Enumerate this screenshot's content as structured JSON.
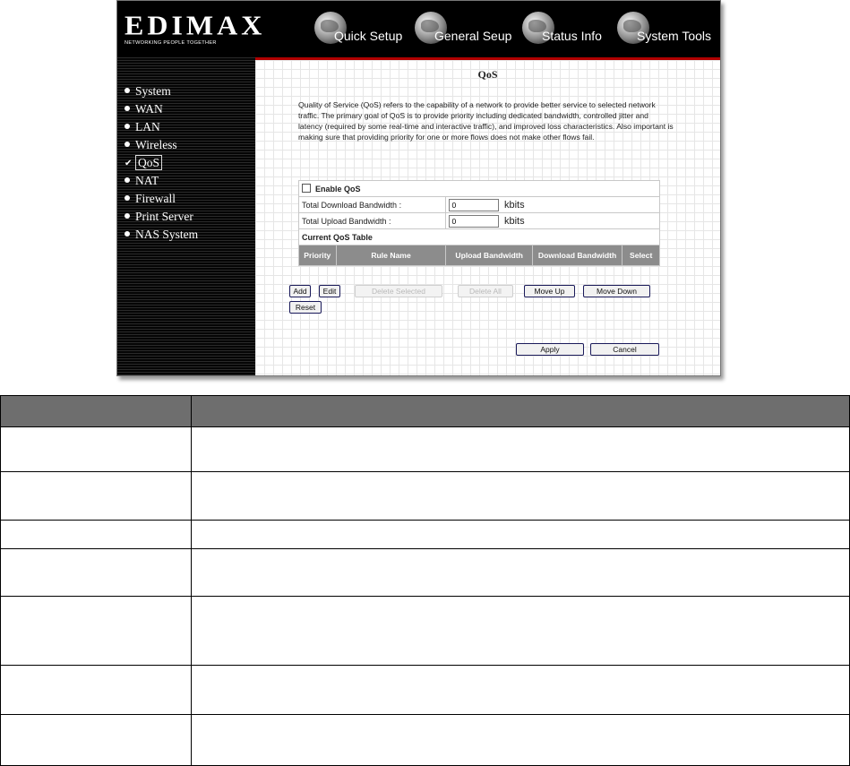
{
  "brand": {
    "logo": "EDIMAX",
    "tagline": "NETWORKING PEOPLE TOGETHER"
  },
  "nav": [
    "Quick Setup",
    "General Seup",
    "Status Info",
    "System Tools"
  ],
  "sidebar": {
    "items": [
      "System",
      "WAN",
      "LAN",
      "Wireless",
      "QoS",
      "NAT",
      "Firewall",
      "Print Server",
      "NAS System"
    ],
    "active": "QoS"
  },
  "page": {
    "title": "QoS",
    "description": "Quality of Service (QoS) refers to the capability of a network to provide better service to selected network traffic. The primary goal of QoS is to provide priority including dedicated bandwidth, controlled jitter and latency (required by some real-time and interactive traffic), and improved loss characteristics. Also important is making sure that providing priority for one or more flows does not make other flows fail."
  },
  "qos_form": {
    "enable_label": "Enable QoS",
    "enable_checked": false,
    "download_label": "Total Download Bandwidth :",
    "download_value": "0",
    "upload_label": "Total Upload Bandwidth :",
    "upload_value": "0",
    "unit": "kbits",
    "table_title": "Current QoS Table",
    "columns": [
      "Priority",
      "Rule Name",
      "Upload Bandwidth",
      "Download Bandwidth",
      "Select"
    ]
  },
  "buttons": {
    "add": "Add",
    "edit": "Edit",
    "delete_selected": "Delete Selected",
    "delete_all": "Delete All",
    "move_up": "Move Up",
    "move_down": "Move Down",
    "reset": "Reset",
    "apply": "Apply",
    "cancel": "Cancel"
  },
  "doc_table": {
    "header": [
      "",
      ""
    ],
    "row_count": 7
  },
  "colors": {
    "banner": "#000000",
    "accent_line": "#b00000",
    "table_header": "#8c8c8c",
    "doc_header": "#6e6e6e"
  }
}
